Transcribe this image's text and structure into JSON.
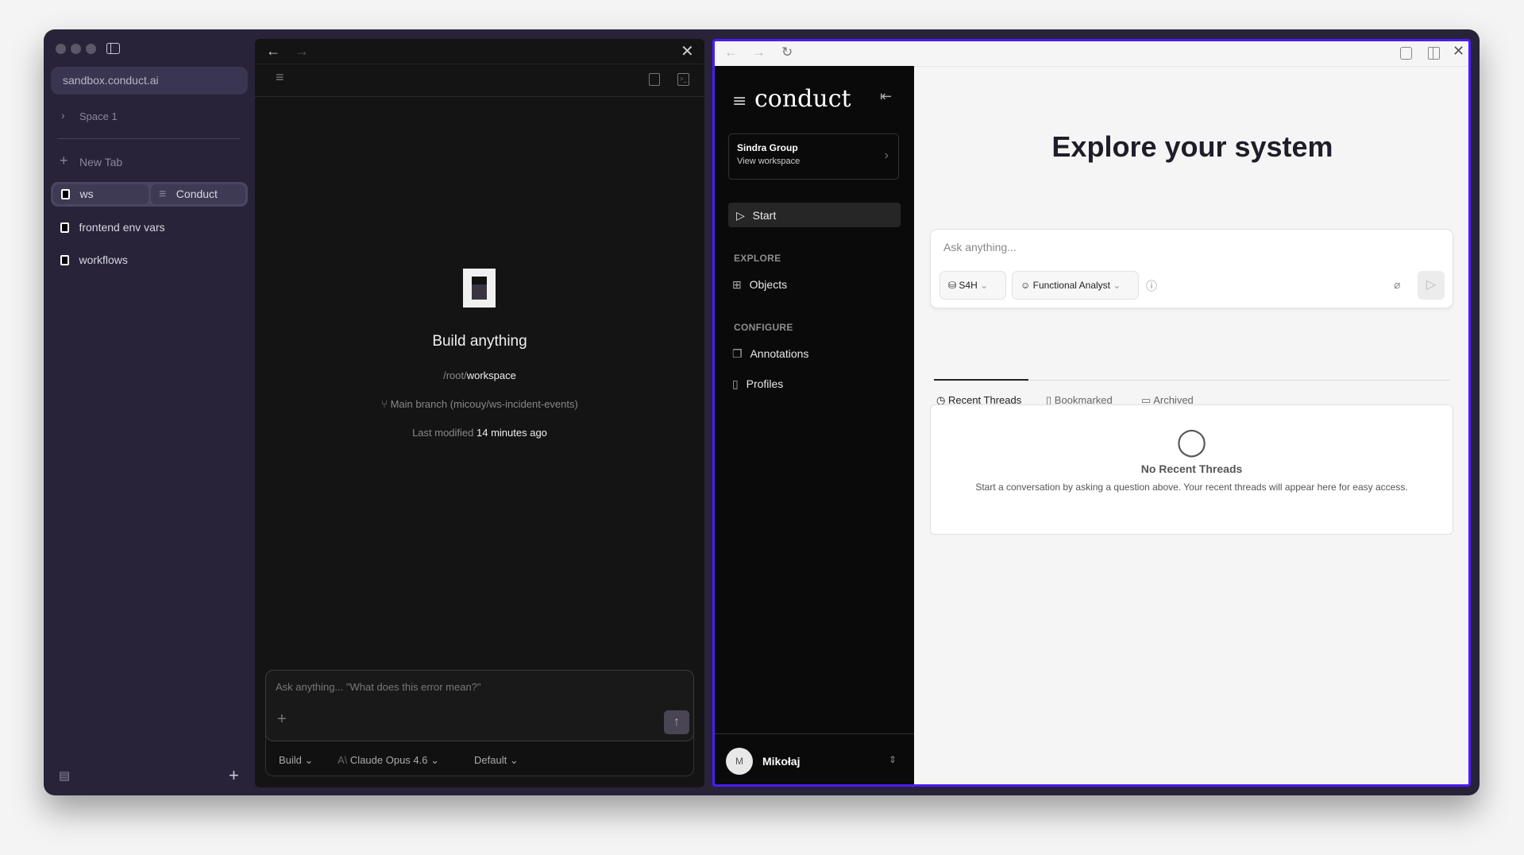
{
  "browser": {
    "url": "sandbox.conduct.ai",
    "space": "Space 1",
    "new_tab": "New Tab",
    "tabs": [
      {
        "label": "ws"
      },
      {
        "label": "Conduct"
      },
      {
        "label": "frontend env vars"
      },
      {
        "label": "workflows"
      }
    ]
  },
  "workspace": {
    "title": "Build anything",
    "path_prefix": "/root/",
    "path_name": "workspace",
    "branch": "Main branch (micouy/ws-incident-events)",
    "modified_label": "Last modified",
    "modified_value": "14 minutes ago",
    "input_placeholder": "Ask anything... \"What does this error mean?\"",
    "mode": "Build",
    "model": "Claude Opus 4.6",
    "profile": "Default"
  },
  "conduct": {
    "logo": "conduct",
    "org": "Sindra Group",
    "org_sub": "View workspace",
    "start": "Start",
    "explore": "EXPLORE",
    "objects": "Objects",
    "configure": "CONFIGURE",
    "annotations": "Annotations",
    "profiles": "Profiles",
    "user": "Mikołaj",
    "user_initial": "M",
    "title": "Explore your system",
    "ask_placeholder": "Ask anything...",
    "system": "S4H",
    "role": "Functional Analyst",
    "tabs": [
      "Recent Threads",
      "Bookmarked",
      "Archived"
    ],
    "empty_title": "No Recent Threads",
    "empty_text": "Start a conversation by asking a question above. Your recent threads will appear here for easy access."
  },
  "colors": {
    "accent": "#4a1cff",
    "sidebar": "#282339"
  }
}
